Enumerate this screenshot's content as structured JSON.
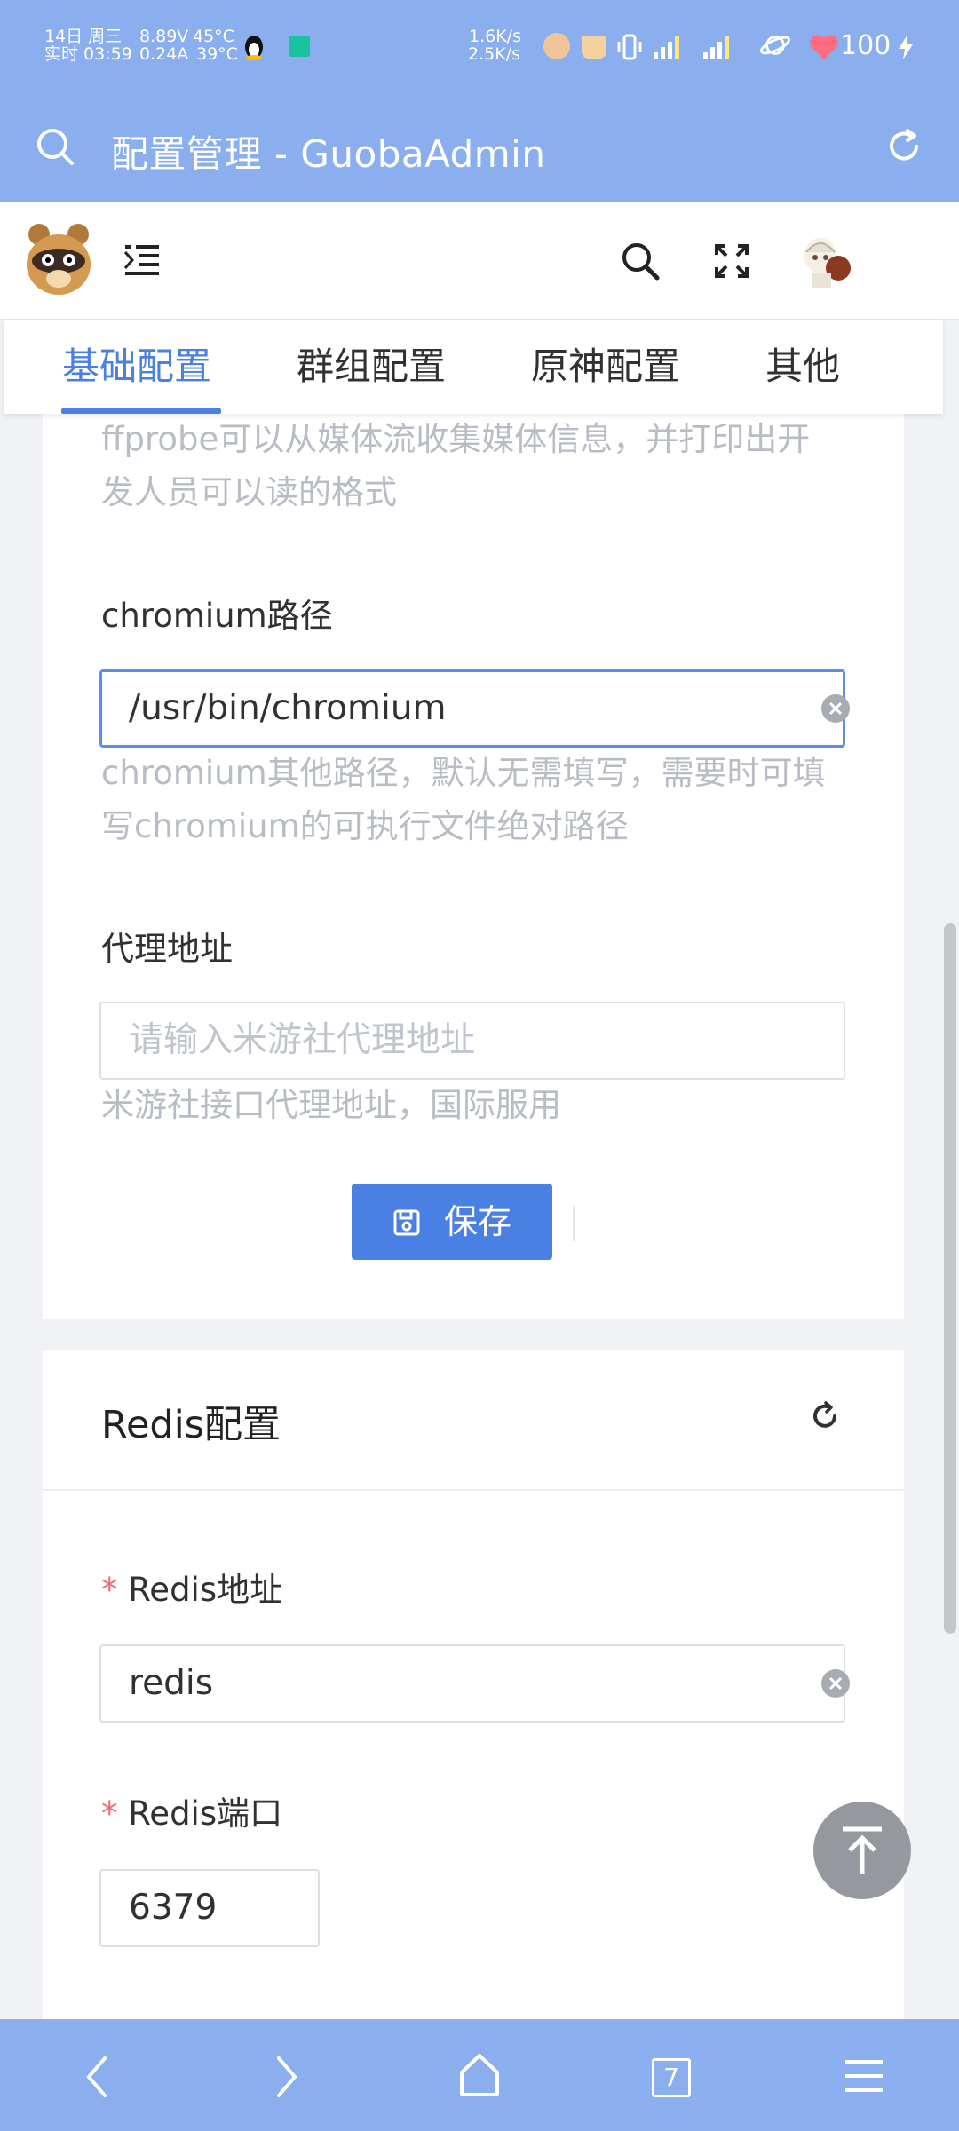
{
  "status_bar": {
    "date": "14日 周三",
    "time": "实时 03:59",
    "voltage": "8.89V",
    "current": "0.24A",
    "temp1": "45°C",
    "temp2": "39°C",
    "net_up": "1.6K/s",
    "net_down": "2.5K/s",
    "battery": "100"
  },
  "browser": {
    "title": "配置管理 - GuobaAdmin"
  },
  "tabs": [
    {
      "label": "基础配置",
      "active": true
    },
    {
      "label": "群组配置",
      "active": false
    },
    {
      "label": "原神配置",
      "active": false
    },
    {
      "label": "其他",
      "active": false
    }
  ],
  "basic_card": {
    "ffprobe_help": [
      "ffprobe可以从媒体流收集媒体信息，并打印出开",
      "发人员可以读的格式"
    ],
    "chromium_label": "chromium路径",
    "chromium_value": "/usr/bin/chromium",
    "chromium_help": [
      "chromium其他路径，默认无需填写，需要时可填",
      "写chromium的可执行文件绝对路径"
    ],
    "proxy_label": "代理地址",
    "proxy_placeholder": "请输入米游社代理地址",
    "proxy_help": "米游社接口代理地址，国际服用",
    "save_label": "保存"
  },
  "redis_card": {
    "title": "Redis配置",
    "required_mark": "*",
    "host_label": "Redis地址",
    "host_value": "redis",
    "port_label": "Redis端口",
    "port_value": "6379"
  },
  "colors": {
    "accent": "#4a7fe3",
    "browser_bar": "#8aaeee",
    "required": "#f56c6c"
  },
  "bottom_nav": {
    "tab_count": "7"
  }
}
